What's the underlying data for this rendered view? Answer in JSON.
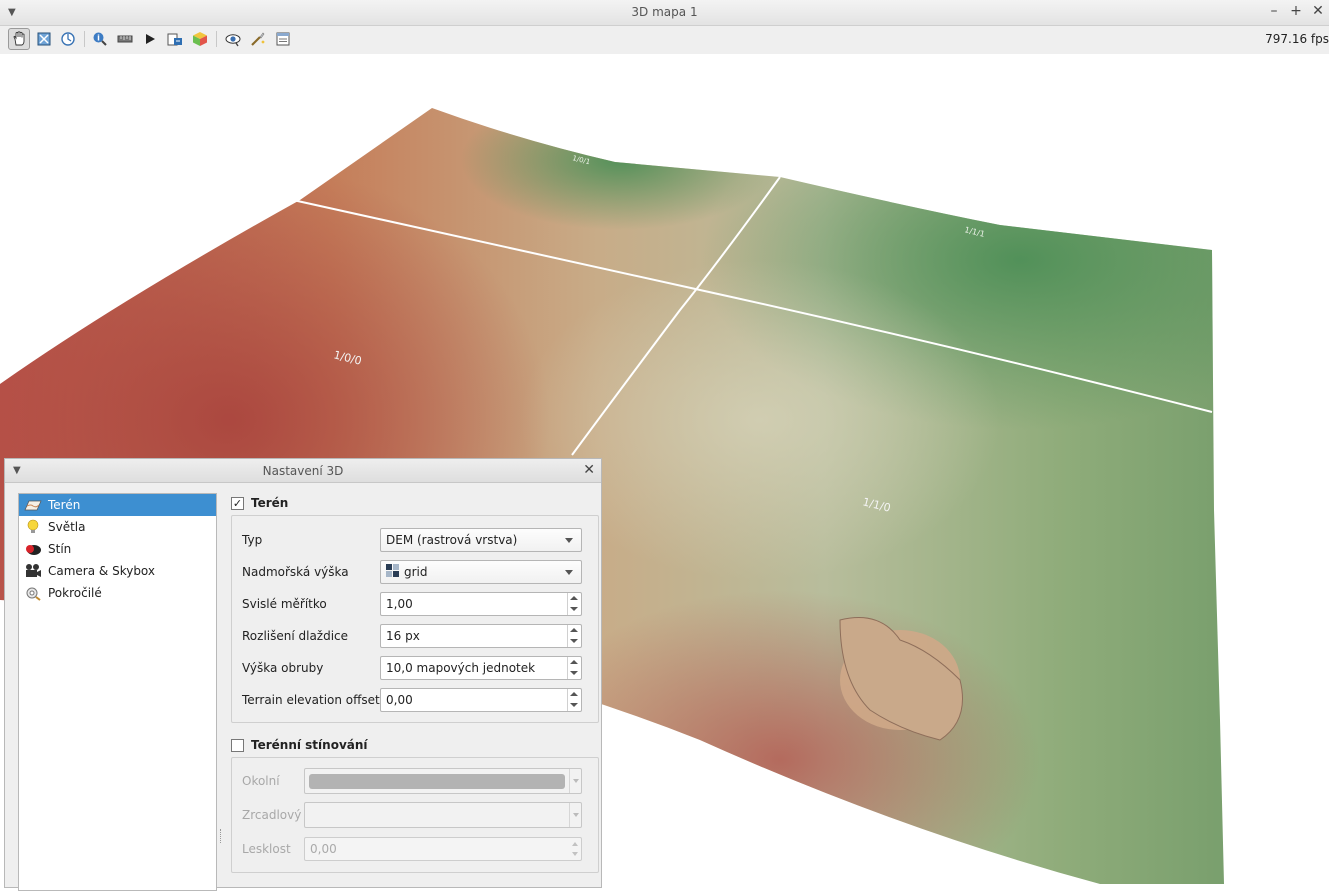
{
  "window": {
    "title": "3D mapa 1",
    "fps": "797.16 fps"
  },
  "toolbar": {
    "items": [
      "pan-icon",
      "zoom-full-icon",
      "reset-view-icon",
      "identify-icon",
      "measure-icon",
      "animation-play-icon",
      "export-scene-icon",
      "options-icon",
      "camera-view-icon",
      "effects-icon",
      "settings-panel-icon"
    ]
  },
  "map_labels": {
    "tile_00": "1/0/0",
    "tile_10": "1/1/0",
    "tile_01": "1/0/1",
    "tile_11": "1/1/1"
  },
  "dock": {
    "title": "Nastavení 3D",
    "nav": [
      {
        "label": "Terén",
        "icon": "terrain-icon",
        "selected": true
      },
      {
        "label": "Světla",
        "icon": "lightbulb-icon",
        "selected": false
      },
      {
        "label": "Stín",
        "icon": "shadow-icon",
        "selected": false
      },
      {
        "label": "Camera & Skybox",
        "icon": "camera-icon",
        "selected": false
      },
      {
        "label": "Pokročilé",
        "icon": "advanced-icon",
        "selected": false
      }
    ],
    "terrain": {
      "header": "Terén",
      "checked": true,
      "type_label": "Typ",
      "type_value": "DEM (rastrová vrstva)",
      "elevation_label": "Nadmořská výška",
      "elevation_value": "grid",
      "vscale_label": "Svislé měřítko",
      "vscale_value": "1,00",
      "tile_res_label": "Rozlišení dlaždice",
      "tile_res_value": "16 px",
      "skirt_label": "Výška obruby",
      "skirt_value": "10,0 mapových jednotek",
      "offset_label": "Terrain elevation offset",
      "offset_value": "0,00"
    },
    "shading": {
      "header": "Terénní stínování",
      "checked": false,
      "ambient_label": "Okolní",
      "specular_label": "Zrcadlový",
      "shininess_label": "Lesklost",
      "shininess_value": "0,00",
      "ambient_color": "#b3b3b3"
    }
  }
}
